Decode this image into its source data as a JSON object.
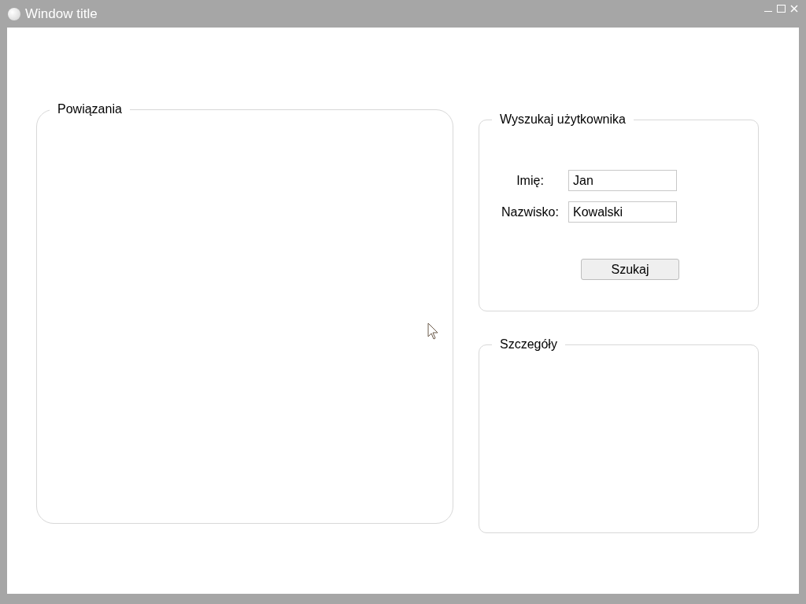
{
  "window": {
    "title": "Window title"
  },
  "links_group": {
    "title": "Powiązania"
  },
  "search_group": {
    "title": "Wyszukaj użytkownika",
    "fields": [
      {
        "label": "Imię:",
        "value": "Jan"
      },
      {
        "label": "Nazwisko:",
        "value": "Kowalski"
      }
    ],
    "button": "Szukaj"
  },
  "details_group": {
    "title": "Szczegóły"
  }
}
